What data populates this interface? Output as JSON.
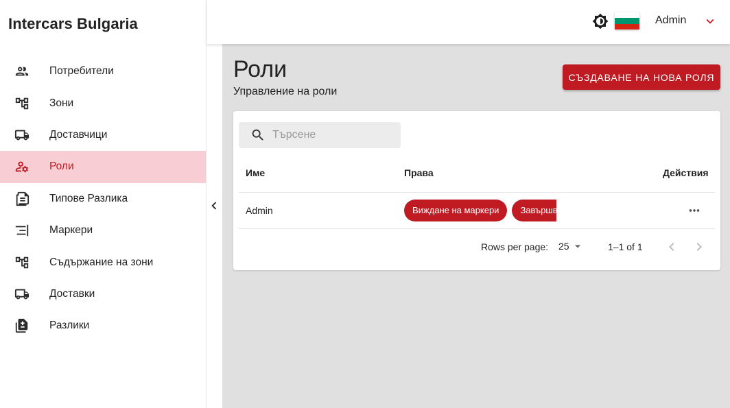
{
  "app": {
    "title": "Intercars Bulgaria"
  },
  "sidebar": {
    "items": [
      {
        "label": "Потребители",
        "icon": "users-icon",
        "active": false
      },
      {
        "label": "Зони",
        "icon": "tree-icon",
        "active": false
      },
      {
        "label": "Доставчици",
        "icon": "truck-icon",
        "active": false
      },
      {
        "label": "Роли",
        "icon": "user-gear-icon",
        "active": true
      },
      {
        "label": "Типове Разлика",
        "icon": "document-list-icon",
        "active": false
      },
      {
        "label": "Маркери",
        "icon": "align-end-icon",
        "active": false
      },
      {
        "label": "Съдържание на зони",
        "icon": "tree-icon",
        "active": false
      },
      {
        "label": "Доставки",
        "icon": "truck-icon",
        "active": false
      },
      {
        "label": "Разлики",
        "icon": "document-diff-icon",
        "active": false
      }
    ]
  },
  "header": {
    "user": "Admin",
    "language_flag": "bulgaria-flag",
    "flag_colors": [
      "#ffffff",
      "#00966e",
      "#d62612"
    ]
  },
  "page": {
    "title": "Роли",
    "subtitle": "Управление на роли",
    "create_button": "СЪЗДАВАНЕ НА НОВА РОЛЯ"
  },
  "table": {
    "search_placeholder": "Търсене",
    "columns": [
      "Име",
      "Права",
      "Действия"
    ],
    "rows": [
      {
        "name": "Admin",
        "permissions": [
          "Виждане на маркери",
          "Завършване"
        ]
      }
    ]
  },
  "pagination": {
    "rows_per_page_label": "Rows per page:",
    "rows_per_page": "25",
    "range": "1–1 of 1"
  },
  "colors": {
    "accent": "#c01a22",
    "active_bg": "#f8cdd4",
    "content_bg": "#e0e0e0"
  }
}
